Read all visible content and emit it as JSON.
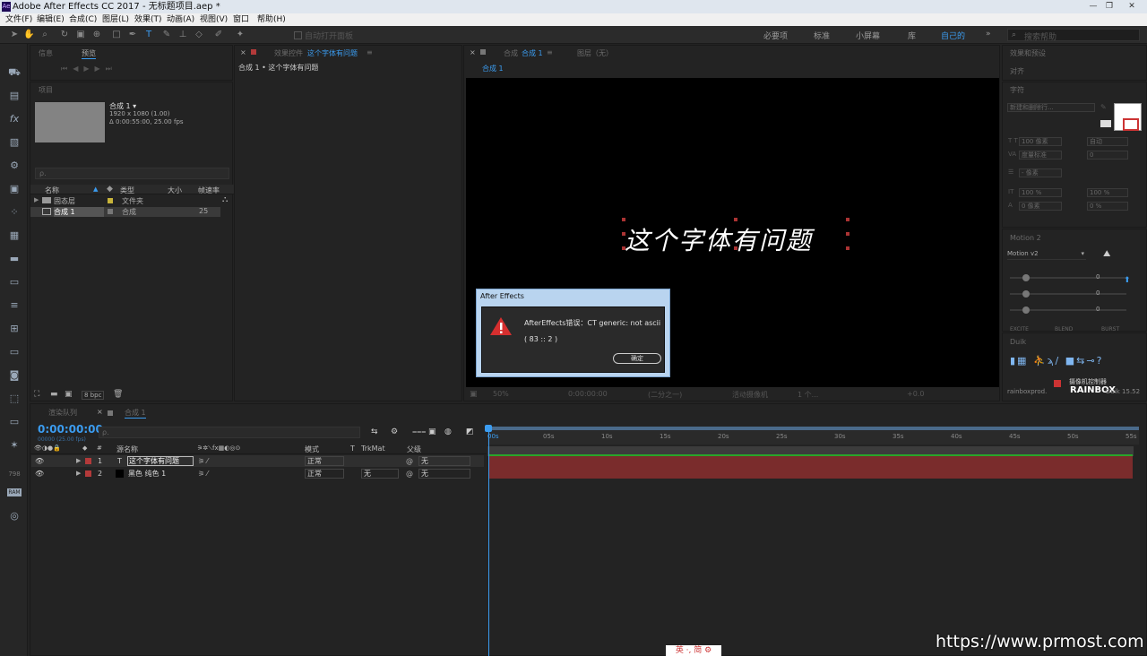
{
  "app": {
    "title": "Adobe After Effects CC 2017 - 无标题项目.aep *",
    "logo": "Ae",
    "minimize": "—",
    "restore": "❐",
    "close": "✕"
  },
  "menu": [
    "文件(F)",
    "编辑(E)",
    "合成(C)",
    "图层(L)",
    "效果(T)",
    "动画(A)",
    "视图(V)",
    "窗口",
    "帮助(H)"
  ],
  "toolbar": {
    "auto_open": "自动打开面板",
    "workspaces": [
      "必要项",
      "标准",
      "小屏幕",
      "库",
      "自己的"
    ],
    "search_placeholder": "搜索帮助"
  },
  "left_icons": [
    "car-icon",
    "image-icon",
    "fx-icon",
    "photo-icon",
    "gear-icon",
    "frame-icon",
    "particles-icon",
    "grid-icon",
    "folder-icon",
    "folder-icon",
    "list-icon",
    "layout-icon",
    "monitor-icon",
    "camera-icon",
    "transform-icon",
    "layers-icon",
    "star-icon",
    "number-icon",
    "ram-icon",
    "speed-icon"
  ],
  "left_labels": {
    "n798": "798",
    "ram": "RAM"
  },
  "info_panel": {
    "tabs": [
      "信息",
      "预览"
    ]
  },
  "project": {
    "tab": "项目",
    "comp_name": "合成 1 ▾",
    "comp_res": "1920 x 1080 (1.00)",
    "comp_dur": "Δ 0:00:55:00, 25.00 fps",
    "search_placeholder": "ρ.",
    "columns": [
      "名称",
      "类型",
      "大小",
      "帧速率"
    ],
    "rows": [
      {
        "name": "固态层",
        "type": "文件夹",
        "rate": ""
      },
      {
        "name": "合成 1",
        "type": "合成",
        "rate": "25"
      }
    ],
    "bpc": "8 bpc"
  },
  "effects": {
    "tab_prefix": "效果控件",
    "tab_name": "这个字体有问题",
    "breadcrumb": "合成 1 • 这个字体有问题"
  },
  "comp": {
    "tab_prefix": "合成",
    "tab_name": "合成 1",
    "tab_layer": "图层（无）",
    "sub_tab": "合成 1",
    "text": "这个字体有问题",
    "bottom": [
      "50%",
      "0:00:00:00",
      "(二分之一)",
      "活动摄像机",
      "1 个...",
      "+0.0"
    ]
  },
  "dialog": {
    "title": "After Effects",
    "message": "AfterEffects错误：CT generic: not ascii",
    "code": "( 83 :: 2 )",
    "ok": "确定"
  },
  "right": {
    "effects_presets": "效果和预设",
    "align": "对齐",
    "character": "字符",
    "font_placeholder": "新建和删除行...",
    "font_size": "100 像素",
    "leading": "自动",
    "tracking": "度量标准",
    "kerning": "0",
    "stroke": "- 像素",
    "vscale": "100 %",
    "hscale": "100 %",
    "baseline": "0 像素",
    "tsume": "0 %",
    "motion_tab": "Motion 2",
    "motion_select": "Motion v2",
    "motion_vals": [
      "0",
      "0",
      "0"
    ],
    "motion_btns": [
      "EXCITE",
      "BLEND",
      "BURST"
    ],
    "duik_tab": "Duik",
    "rainbox": "rainboxprod.",
    "rainbox_logo": "RAINBOX",
    "duik_ver": "Duik 15.52",
    "camera_ctrl": "摄像机控制器"
  },
  "timeline": {
    "tabs": [
      "渲染队列",
      "合成 1"
    ],
    "timecode": "0:00:00:00",
    "timecode_sub": "00000 (25.00 fps)",
    "search_placeholder": "ρ.",
    "headers": [
      "源名称",
      "模式",
      "T",
      "TrkMat",
      "父级"
    ],
    "layers": [
      {
        "num": "1",
        "type": "T",
        "name": "这个字体有问题",
        "mode": "正常",
        "trkmat": "",
        "parent": "无"
      },
      {
        "num": "2",
        "type": "■",
        "name": "黑色 纯色 1",
        "mode": "正常",
        "trkmat": "无",
        "parent": "无"
      }
    ],
    "ticks": [
      "00s",
      "05s",
      "10s",
      "15s",
      "20s",
      "25s",
      "30s",
      "35s",
      "40s",
      "45s",
      "50s",
      "55s"
    ]
  },
  "watermark": "https://www.prmost.com",
  "ime": "英 ·, 简 ⚙",
  "colors": {
    "accent": "#3b9cf0",
    "label_red": "#b33a3a",
    "track_red": "#7a2c2c",
    "ok_green": "#2aa52a"
  }
}
